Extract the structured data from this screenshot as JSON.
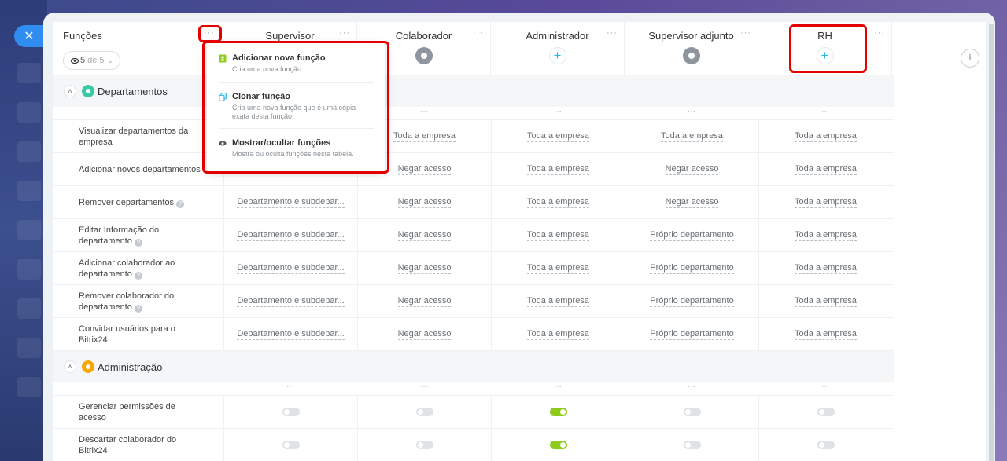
{
  "close_label": "✕",
  "header": {
    "first_col_title": "Funções",
    "counter_current": "5",
    "counter_rest": "de 5",
    "columns": [
      {
        "title": "Supervisor",
        "icon": "none"
      },
      {
        "title": "Colaborador",
        "icon": "user-avatar-icon"
      },
      {
        "title": "Administrador",
        "icon": "plus-icon"
      },
      {
        "title": "Supervisor adjunto",
        "icon": "group-avatar-icon"
      },
      {
        "title": "RH",
        "icon": "plus-icon"
      }
    ],
    "dots": "···",
    "plus": "+"
  },
  "menu": {
    "items": [
      {
        "title": "Adicionar nova função",
        "desc": "Cria uma nova função."
      },
      {
        "title": "Clonar função",
        "desc": "Cria uma nova função que é uma cópia exata desta função."
      },
      {
        "title": "Mostrar/ocultar funções",
        "desc": "Mostra ou oculta funções nesta tabela."
      }
    ]
  },
  "sections": [
    {
      "title": "Departamentos",
      "color": "#3bc8a8",
      "rows": [
        {
          "label": "Visualizar departamentos da empresa",
          "help": false,
          "values": [
            "",
            "Toda a empresa",
            "Toda a empresa",
            "Toda a empresa",
            "Toda a empresa"
          ]
        },
        {
          "label": "Adicionar novos departamentos",
          "help": false,
          "values": [
            "",
            "Negar acesso",
            "Toda a empresa",
            "Negar acesso",
            "Toda a empresa"
          ]
        },
        {
          "label": "Remover departamentos",
          "help": true,
          "values": [
            "Departamento e subdepar...",
            "Negar acesso",
            "Toda a empresa",
            "Negar acesso",
            "Toda a empresa"
          ]
        },
        {
          "label": "Editar Informação do departamento",
          "help": true,
          "values": [
            "Departamento e subdepar...",
            "Negar acesso",
            "Toda a empresa",
            "Próprio departamento",
            "Toda a empresa"
          ]
        },
        {
          "label": "Adicionar colaborador ao departamento",
          "help": true,
          "values": [
            "Departamento e subdepar...",
            "Negar acesso",
            "Toda a empresa",
            "Próprio departamento",
            "Toda a empresa"
          ]
        },
        {
          "label": "Remover colaborador do departamento",
          "help": true,
          "values": [
            "Departamento e subdepar...",
            "Negar acesso",
            "Toda a empresa",
            "Próprio departamento",
            "Toda a empresa"
          ]
        },
        {
          "label": "Convidar usuários para o Bitrix24",
          "help": false,
          "values": [
            "Departamento e subdepar...",
            "Negar acesso",
            "Toda a empresa",
            "Próprio departamento",
            "Toda a empresa"
          ]
        }
      ]
    },
    {
      "title": "Administração",
      "color": "#f7a700",
      "rows": [
        {
          "label": "Gerenciar permissões de acesso",
          "toggles": [
            false,
            false,
            true,
            false,
            false
          ]
        },
        {
          "label": "Descartar colaborador do Bitrix24",
          "toggles": [
            false,
            false,
            true,
            false,
            false
          ]
        }
      ]
    }
  ],
  "colors": {
    "accent": "#2f8cf0",
    "highlight": "#e50000",
    "toggle_on": "#8fcb1a"
  }
}
